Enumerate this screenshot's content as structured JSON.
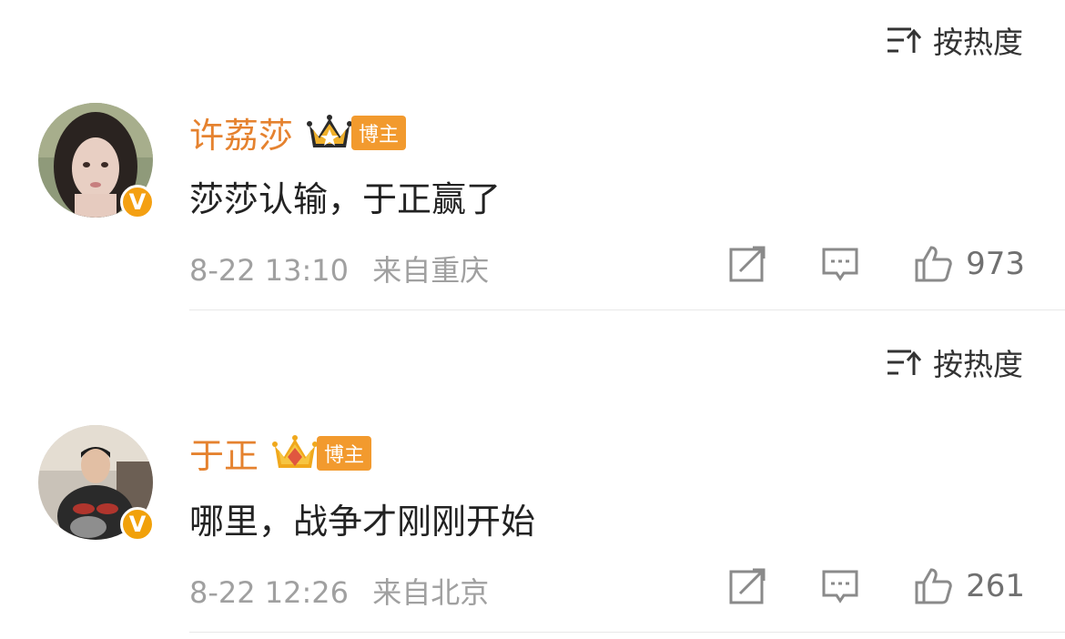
{
  "comments": [
    {
      "sort_label": "按热度",
      "sort_icon": "sort-hot-icon",
      "username": "许荔莎",
      "level_icon": "crown-level-icon",
      "badge": "博主",
      "verified_mark": "V",
      "text": "莎莎认输，于正赢了",
      "date": "8-22 13:10",
      "location": "来自重庆",
      "like_count": "973"
    },
    {
      "sort_label": "按热度",
      "sort_icon": "sort-hot-icon",
      "username": "于正",
      "level_icon": "crown-level-icon",
      "badge": "博主",
      "verified_mark": "V",
      "text": "哪里，战争才刚刚开始",
      "date": "8-22 12:26",
      "location": "来自北京",
      "like_count": "261"
    }
  ],
  "colors": {
    "username": "#e5822f",
    "badge_bg": "#f29a2e",
    "verified": "#f4a012",
    "meta": "#a0a0a0"
  }
}
